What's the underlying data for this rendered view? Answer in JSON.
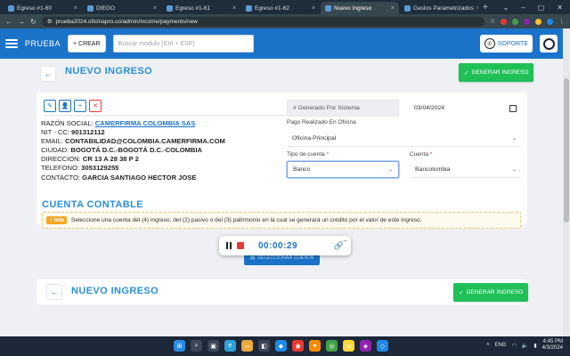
{
  "browser": {
    "tabs": [
      {
        "label": "Egreso #1-60",
        "active": false
      },
      {
        "label": "DIEGO",
        "active": false
      },
      {
        "label": "Egreso #1-61",
        "active": false
      },
      {
        "label": "Egreso #1-62",
        "active": false
      },
      {
        "label": "Nuevo Ingreso",
        "active": true
      },
      {
        "label": "Gastos Parametrizados",
        "active": false
      }
    ],
    "url": "prueba2024.oficinapro.co/admin/income/payments/new"
  },
  "header": {
    "brand": "PRUEBA",
    "crear_label": "+ CREAR",
    "search_placeholder": "Buscar modulo (Ctrl + ESP)",
    "soporte_label": "SOPORTE"
  },
  "page": {
    "title": "NUEVO INGRESO",
    "generate_label": "GENERAR INGRESO"
  },
  "contact": {
    "razon_label": "RAZÓN SOCIAL:",
    "razon_value": "CAMERFIRMA COLOMBIA SAS",
    "nit_label": "NIT - CC:",
    "nit_value": "901312112",
    "email_label": "EMAIL:",
    "email_value": "CONTABILIDAD@COLOMBIA.CAMERFIRMA.COM",
    "ciudad_label": "CIUDAD:",
    "ciudad_value": "BOGOTÁ D.C.-BOGOTÁ D.C.-COLOMBIA",
    "direccion_label": "DIRECCION:",
    "direccion_value": "CR 13 A 28 38 P 2",
    "telefono_label": "TELEFONO:",
    "telefono_value": "3053129255",
    "contacto_label": "CONTACTO:",
    "contacto_value": "GARCIA SANTIAGO HECTOR JOSE"
  },
  "form": {
    "numero_placeholder": "# Generado Por Sistema",
    "fecha": "03/04/2024",
    "pago_label": "Pago Realizado En Oficina",
    "oficina_value": "Oficina Principal",
    "tipo_label": "Tipo de cuenta",
    "tipo_value": "Banco",
    "cuenta_label": "Cuenta",
    "cuenta_value": "Bancolombia",
    "required_mark": "*"
  },
  "contable": {
    "title": "CUENTA CONTABLE",
    "info_badge": "Info",
    "info_text": "Seleccione una cuenta del (4) ingreso, del (2) pasivo o del (3) patrimonio en la cual se generará un crédito por el valor de este ingreso.",
    "select_label": "SELECCIONAR CUENTA"
  },
  "recorder": {
    "time": "00:00:29"
  },
  "taskbar": {
    "lang": "ENG",
    "time": "4:45 PM",
    "date": "4/3/2024"
  },
  "colors": {
    "primary": "#1a73c9",
    "success": "#1fc058",
    "danger": "#e53935"
  }
}
